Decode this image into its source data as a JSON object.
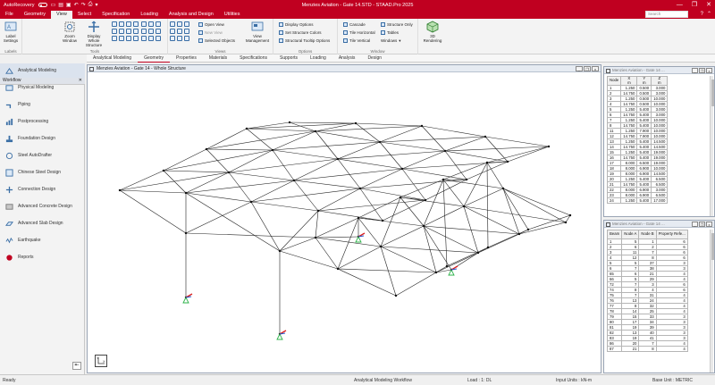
{
  "titlebar": {
    "autorecovery_label": "AutoRecovery",
    "toggle_state": "Off",
    "title": "Menzies Aviation - Gate 14.STD - STAAD.Pro 2025",
    "minimize": "—",
    "restore": "❐",
    "close": "✕"
  },
  "menu": {
    "tabs": [
      "File",
      "Geometry",
      "View",
      "Select",
      "Specification",
      "Loading",
      "Analysis and Design",
      "Utilities"
    ],
    "active_tab": "View",
    "search_placeholder": "Search"
  },
  "ribbon": {
    "groups": {
      "labels": {
        "label": "Labels",
        "button": "Label Settings"
      },
      "tools": {
        "label": "Tools",
        "zoom_window": "Zoom Window",
        "display_whole": "Display Whole Structure"
      },
      "views": {
        "label": "Views",
        "open_view": "Open View",
        "new_view": "New View",
        "selected_objects": "Selected Objects",
        "view_management": "View Management"
      },
      "options": {
        "label": "Options",
        "display_options": "Display Options",
        "set_structure_colors": "Set Structure Colors",
        "structural_tooltip": "Structural Tooltip Options"
      },
      "window": {
        "label": "Window",
        "cascade": "Cascade",
        "tile_horizontal": "Tile Horizontal",
        "tile_vertical": "Tile Vertical",
        "structure_only": "Structure Only",
        "tables": "Tables",
        "windows": "Windows"
      },
      "rendering": {
        "button": "3D Rendering"
      }
    }
  },
  "subtabs": {
    "items": [
      "Analytical Modeling",
      "Geometry",
      "Properties",
      "Materials",
      "Specifications",
      "Supports",
      "Loading",
      "Analysis",
      "Design"
    ],
    "active": "Geometry"
  },
  "workflow": {
    "header": "Workflow",
    "close": "✕",
    "items": [
      "Analytical Modeling",
      "Physical Modeling",
      "Piping",
      "Postprocessing",
      "Foundation Design",
      "Steel AutoDrafter",
      "Chinese Steel Design",
      "Connection Design",
      "Advanced Concrete Design",
      "Advanced Slab Design",
      "Earthquake",
      "Reports"
    ],
    "active": "Analytical Modeling",
    "collapse": "⇤"
  },
  "viewport": {
    "title": "Menzies Aviation - Gate 14 - Whole Structure",
    "axes_label": "Y  X"
  },
  "node_table": {
    "title": "Menzies Aviation - Gate 14 ...",
    "headers": [
      "Node",
      "X\nm",
      "Y\nm",
      "Z\nm"
    ],
    "rows": [
      [
        "1",
        "1.250",
        "0.500",
        "3.000"
      ],
      [
        "2",
        "14.750",
        "0.500",
        "3.000"
      ],
      [
        "3",
        "1.250",
        "0.500",
        "10.000"
      ],
      [
        "4",
        "14.750",
        "0.500",
        "10.000"
      ],
      [
        "5",
        "1.250",
        "5.400",
        "3.000"
      ],
      [
        "6",
        "14.750",
        "5.400",
        "3.000"
      ],
      [
        "7",
        "1.250",
        "5.400",
        "10.000"
      ],
      [
        "8",
        "14.750",
        "5.400",
        "10.000"
      ],
      [
        "11",
        "1.250",
        "7.900",
        "10.000"
      ],
      [
        "12",
        "14.750",
        "7.900",
        "10.000"
      ],
      [
        "13",
        "1.250",
        "5.400",
        "14.500"
      ],
      [
        "14",
        "14.750",
        "5.400",
        "14.500"
      ],
      [
        "15",
        "1.250",
        "5.400",
        "19.000"
      ],
      [
        "16",
        "14.750",
        "5.400",
        "19.000"
      ],
      [
        "17",
        "8.000",
        "6.500",
        "19.000"
      ],
      [
        "18",
        "8.000",
        "6.900",
        "10.000"
      ],
      [
        "19",
        "8.000",
        "6.900",
        "14.500"
      ],
      [
        "20",
        "1.250",
        "5.400",
        "6.500"
      ],
      [
        "21",
        "14.750",
        "5.400",
        "6.500"
      ],
      [
        "22",
        "8.000",
        "6.900",
        "3.000"
      ],
      [
        "23",
        "8.000",
        "6.900",
        "6.500"
      ],
      [
        "24",
        "1.250",
        "5.400",
        "17.000"
      ]
    ]
  },
  "beam_table": {
    "title": "Menzies Aviation - Gate 14 ...",
    "headers": [
      "Beam",
      "Node A",
      "Node B",
      "Property Refe..."
    ],
    "rows": [
      [
        "1",
        "5",
        "1",
        "6"
      ],
      [
        "2",
        "6",
        "2",
        "6"
      ],
      [
        "3",
        "11",
        "7",
        "6"
      ],
      [
        "4",
        "12",
        "8",
        "6"
      ],
      [
        "5",
        "5",
        "37",
        "3"
      ],
      [
        "6",
        "7",
        "38",
        "3"
      ],
      [
        "65",
        "6",
        "21",
        "4"
      ],
      [
        "66",
        "5",
        "29",
        "4"
      ],
      [
        "72",
        "7",
        "3",
        "6"
      ],
      [
        "74",
        "8",
        "4",
        "6"
      ],
      [
        "75",
        "7",
        "31",
        "4"
      ],
      [
        "76",
        "13",
        "24",
        "4"
      ],
      [
        "77",
        "8",
        "32",
        "4"
      ],
      [
        "78",
        "14",
        "25",
        "4"
      ],
      [
        "79",
        "15",
        "33",
        "3"
      ],
      [
        "80",
        "17",
        "34",
        "3"
      ],
      [
        "81",
        "19",
        "39",
        "3"
      ],
      [
        "82",
        "13",
        "40",
        "3"
      ],
      [
        "83",
        "19",
        "41",
        "3"
      ],
      [
        "86",
        "20",
        "7",
        "4"
      ],
      [
        "87",
        "21",
        "8",
        "4"
      ]
    ]
  },
  "status": {
    "left": "Ready",
    "workflow": "Analytical Modeling Workflow",
    "load": "Load : 1: DL",
    "input_units": "Input Units : kN-m",
    "base_unit": "Base Unit : METRIC"
  },
  "colors": {
    "brand_red": "#c00020",
    "support_green": "#2db34a",
    "support_red": "#d92020",
    "support_blue": "#2255cc"
  }
}
